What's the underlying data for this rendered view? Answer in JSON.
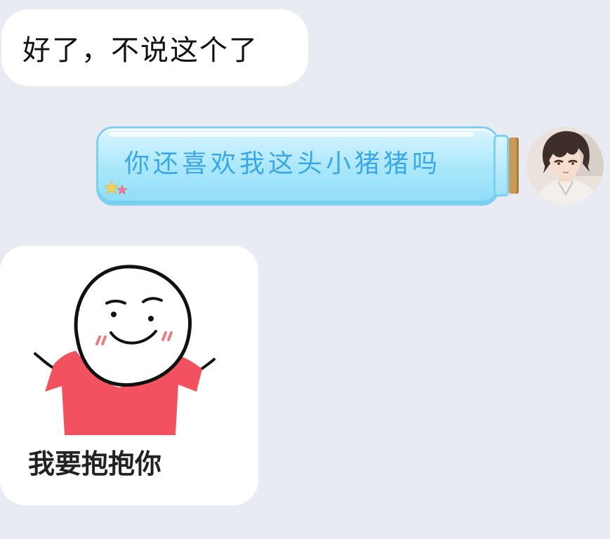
{
  "messages": {
    "incoming_text": "好了，不说这个了",
    "outgoing_text": "你还喜欢我这头小猪猪吗",
    "sticker_caption": "我要抱抱你"
  },
  "colors": {
    "background": "#e9ebf2",
    "bottle_text": "#3aa8e6",
    "shirt": "#f2525f"
  },
  "icons": {
    "stars": "stars-decoration-icon",
    "avatar": "anime-boy-avatar"
  }
}
